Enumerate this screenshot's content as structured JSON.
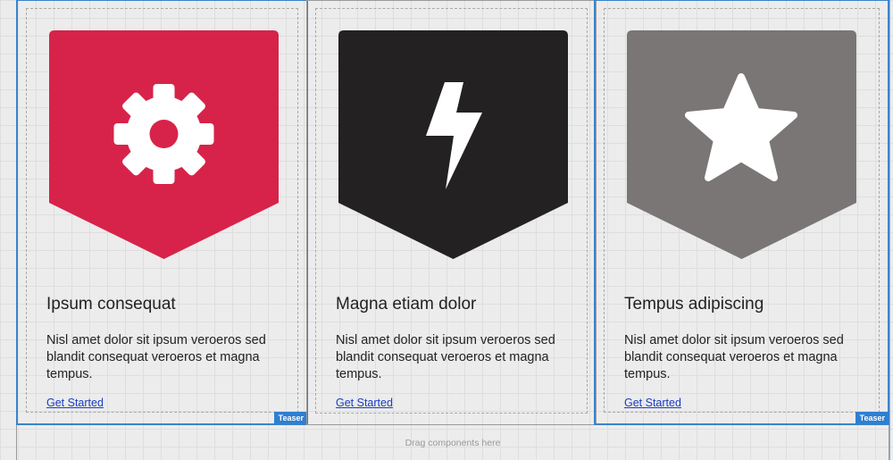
{
  "colors": {
    "card_1_shield": "#d72349",
    "card_2_shield": "#232122",
    "card_3_shield": "#7a7676",
    "selection": "#3a84c9"
  },
  "cards": [
    {
      "icon": "gear-icon",
      "title": "Ipsum consequat",
      "description": "Nisl amet dolor sit ipsum veroeros sed blandit consequat veroeros et magna tempus.",
      "link_label": "Get Started",
      "badge": "Teaser"
    },
    {
      "icon": "lightning-bolt-icon",
      "title": "Magna etiam dolor",
      "description": "Nisl amet dolor sit ipsum veroeros sed blandit consequat veroeros et magna tempus.",
      "link_label": "Get Started"
    },
    {
      "icon": "star-icon",
      "title": "Tempus adipiscing",
      "description": "Nisl amet dolor sit ipsum veroeros sed blandit consequat veroeros et magna tempus.",
      "link_label": "Get Started",
      "badge": "Teaser"
    }
  ],
  "dropzone": {
    "label": "Drag components here"
  }
}
